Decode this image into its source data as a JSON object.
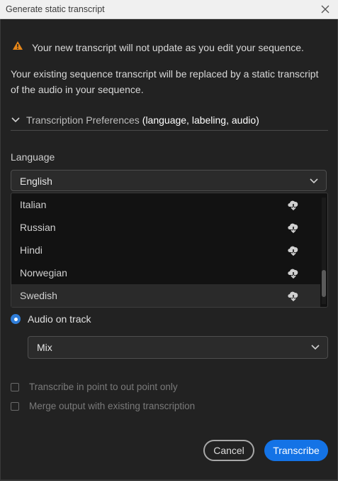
{
  "window": {
    "title": "Generate static transcript"
  },
  "warning": {
    "text": "Your new transcript will not update as you edit your sequence."
  },
  "description": "Your existing sequence transcript will be replaced by a static transcript of the audio in your sequence.",
  "preferences": {
    "label": "Transcription Preferences",
    "detail": "(language, labeling, audio)"
  },
  "language": {
    "label": "Language",
    "selected": "English",
    "options": [
      "Italian",
      "Russian",
      "Hindi",
      "Norwegian",
      "Swedish"
    ],
    "hovered_option": "Swedish"
  },
  "audio": {
    "radio_label": "Audio on track",
    "track_selected": "Mix"
  },
  "options": {
    "in_out_label": "Transcribe in point to out point only",
    "merge_label": "Merge output with existing transcription"
  },
  "buttons": {
    "cancel": "Cancel",
    "transcribe": "Transcribe"
  },
  "colors": {
    "accent": "#1473e6",
    "warning": "#e68619",
    "background": "#222222"
  },
  "icons": {
    "close": "close-icon",
    "warning": "warning-icon",
    "chevron": "chevron-down-icon",
    "download": "cloud-download-icon"
  }
}
